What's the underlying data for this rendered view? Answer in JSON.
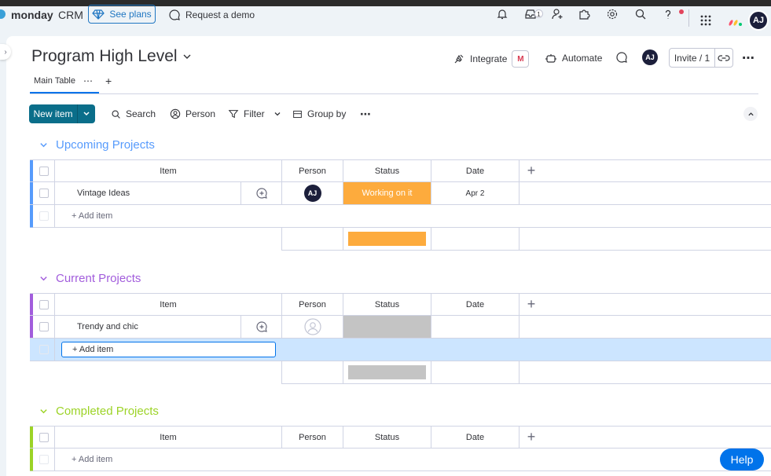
{
  "topbar": {
    "brand": "monday",
    "brand_sub": "CRM",
    "see_plans": "See plans",
    "request_demo": "Request a demo",
    "inbox_badge": "1",
    "avatar": "AJ"
  },
  "board": {
    "title": "Program High Level",
    "integrate": "Integrate",
    "integrate_badge": "M",
    "automate": "Automate",
    "avatar": "AJ",
    "invite": "Invite / 1"
  },
  "tabs": [
    {
      "label": "Main Table"
    }
  ],
  "toolbar": {
    "new_item": "New item",
    "search": "Search",
    "person": "Person",
    "filter": "Filter",
    "group_by": "Group by"
  },
  "columns": [
    "Item",
    "Person",
    "Status",
    "Date"
  ],
  "groups": [
    {
      "title": "Upcoming Projects",
      "color": "#579bfc",
      "rows": [
        {
          "item": "Vintage Ideas",
          "person": "AJ",
          "status": "Working on it",
          "status_color": "#fdab3d",
          "date": "Apr 2"
        }
      ],
      "add_item": "+ Add item"
    },
    {
      "title": "Current Projects",
      "color": "#a25ddc",
      "rows": [
        {
          "item": "Trendy and chic",
          "person": "",
          "status": "",
          "status_color": "#c4c4c4",
          "date": ""
        }
      ],
      "add_item": "+ Add item"
    },
    {
      "title": "Completed Projects",
      "color": "#9cd326",
      "rows": [],
      "add_item": "+ Add item"
    }
  ],
  "help": "Help"
}
